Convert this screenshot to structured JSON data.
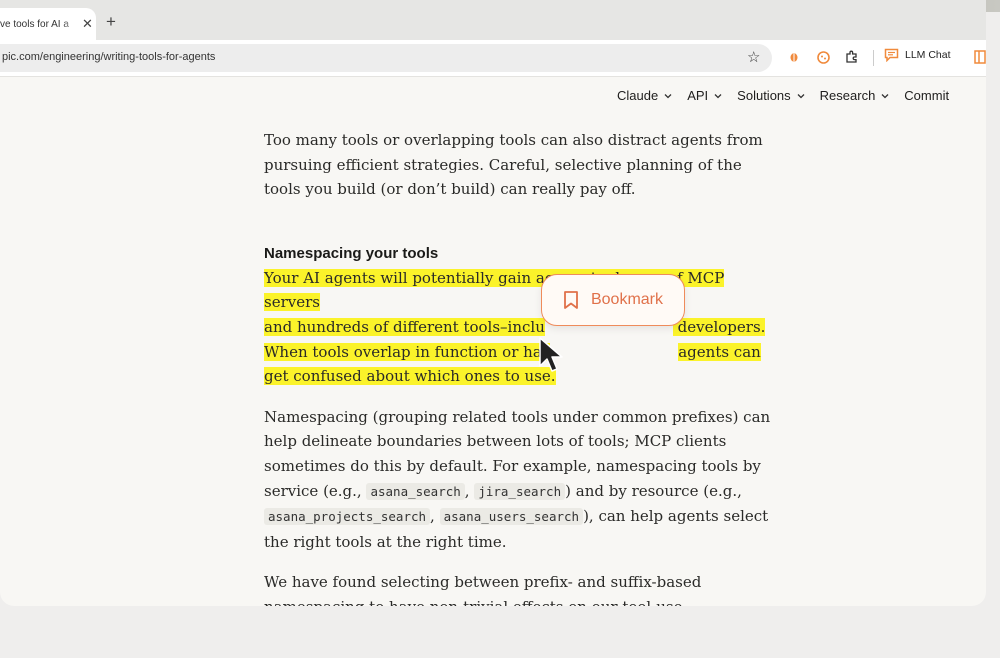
{
  "browser": {
    "tab_title": "ve tools for AI a",
    "tab_close": "✕",
    "new_tab": "+",
    "url": "pic.com/engineering/writing-tools-for-agents",
    "bookmark_star": "☆",
    "llm_chat_label": "LLM Chat",
    "extensions": [
      "bug-extension-icon",
      "cookie-extension-icon",
      "puzzle-extensions-icon",
      "chat-extension-icon",
      "sidebar-extension-icon"
    ]
  },
  "site_nav": {
    "items": [
      {
        "label": "Claude"
      },
      {
        "label": "API"
      },
      {
        "label": "Solutions"
      },
      {
        "label": "Research"
      },
      {
        "label": "Commit"
      }
    ]
  },
  "article": {
    "para1": "Too many tools or overlapping tools can also distract agents from pursuing efficient strategies. Careful, selective planning of the tools you build (or don’t build) can really pay off.",
    "heading": "Namespacing your tools",
    "highlight_line1": "Your AI agents will potentially gain access to dozens of MCP servers",
    "highlight_line2": "and hundreds of different tools–inclu",
    "highlight_line2_end": " developers.",
    "highlight_line3": "When tools overlap in function or hav",
    "highlight_line3_end": "agents can",
    "highlight_line4": "get confused about which ones to use.",
    "para3_a": "Namespacing (grouping related tools under common prefixes) can help delineate boundaries between lots of tools; MCP clients sometimes do this by default. For example, namespacing tools by service (e.g., ",
    "code1": "asana_search",
    "para3_b": ", ",
    "code2": "jira_search",
    "para3_c": ") and by resource (e.g., ",
    "code3": "asana_projects_search",
    "para3_d": ", ",
    "code4": "asana_users_search",
    "para3_e": "), can help agents select the right tools at the right time.",
    "para4": "We have found selecting between prefix- and suffix-based namespacing to have non-trivial effects on our tool-use evaluations. Effects vary by LLM and we encourage you to choose a naming"
  },
  "bookmark_popup": {
    "label": "Bookmark",
    "accent": "#e0714a"
  },
  "colors": {
    "highlight": "#fbf32a",
    "text": "#2a2a28",
    "page_bg": "#f8f7f4"
  }
}
